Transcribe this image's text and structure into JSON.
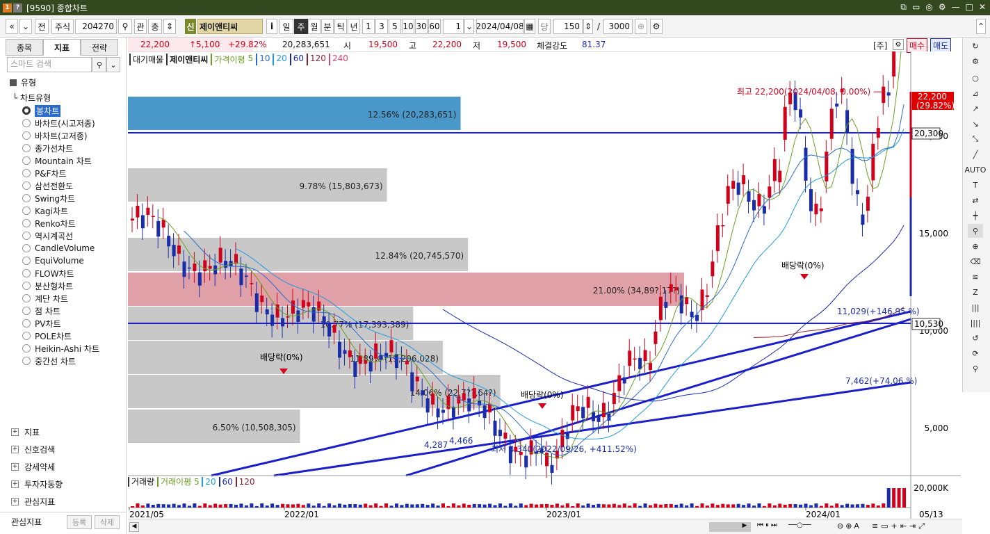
{
  "window": {
    "title": "[9590] 종합차트",
    "icon1": "1",
    "icon2": "?"
  },
  "toolbar": {
    "asset_type": "주식",
    "code": "204270",
    "link_label": "관",
    "sort_label": "충",
    "new_badge": "신",
    "stock_name": "제이앤티씨",
    "info": "i",
    "periods": [
      "일",
      "주",
      "월",
      "분",
      "틱",
      "년"
    ],
    "selected_period": "주",
    "intervals": [
      "1",
      "3",
      "5",
      "10",
      "30",
      "60"
    ],
    "interval_value": "1",
    "date": "2024/04/08",
    "count_label": "당",
    "count": "150",
    "slash": "/",
    "total": "3000"
  },
  "left_panel": {
    "tabs": [
      "종목",
      "지표",
      "전략"
    ],
    "active_tab": "지표",
    "search_placeholder": "스마트 검색",
    "section_title": "유형",
    "subsection": "차트유형",
    "chart_types": [
      "봉차트",
      "바차트(시고저종)",
      "바차트(고저종)",
      "종가선차트",
      "Mountain 차트",
      "P&F차트",
      "삼선전환도",
      "Swing차트",
      "Kagi차트",
      "Renko차트",
      "역시계곡선",
      "CandleVolume",
      "EquiVolume",
      "FLOW차트",
      "분산형차트",
      "계단 차트",
      "점 차트",
      "PV차트",
      "POLE차트",
      "Heikin-Ashi 차트",
      "중간선 차트"
    ],
    "selected_type": "봉차트",
    "expandables": [
      "지표",
      "신호검색",
      "강세약세",
      "투자자동향",
      "관심지표"
    ],
    "footer_label": "관심지표",
    "register": "등록",
    "delete": "삭제"
  },
  "price_bar": {
    "price": "22,200",
    "change": "↑5,100",
    "rate": "+29.82%",
    "volume": "20,283,651",
    "open_label": "시",
    "open": "19,500",
    "high_label": "고",
    "high": "22,200",
    "low_label": "저",
    "low": "19,500",
    "strength_label": "체결강도",
    "strength": "81.37",
    "right_label": "[주]",
    "buy": "매수",
    "sell": "매도"
  },
  "legend": {
    "item1": "대기매물",
    "item2": "제이앤티씨",
    "ma_label": "가격이평",
    "ma": [
      "5",
      "10",
      "20",
      "60",
      "120",
      "240"
    ],
    "ma_colors": [
      "#6aa121",
      "#2a6bd0",
      "#1f9adf",
      "#1a2ca8",
      "#8b1f2f",
      "#e04070"
    ]
  },
  "chart_data": {
    "type": "candlestick",
    "y_axis_ticks": [
      "20,000",
      "15,000",
      "10,000",
      "5,000"
    ],
    "x_axis_ticks": [
      "2021/05",
      "2022/01",
      "2023/01",
      "2024/01"
    ],
    "last_date_label": "05/13",
    "volume_profile": [
      {
        "label": "12.56% (20,283,651)",
        "pct": 12.56,
        "color": "#4a97c9"
      },
      {
        "label": "9.78% (15,803,673)",
        "pct": 9.78,
        "color": "#c8c8c8"
      },
      {
        "label": "12.84% (20,745,570)",
        "pct": 12.84,
        "color": "#c8c8c8"
      },
      {
        "label": "21.00% (34,89?,17?)",
        "pct": 21.0,
        "color": "#e0a0a8"
      },
      {
        "label": "10.77% (17,393,389)",
        "pct": 10.77,
        "color": "#c8c8c8"
      },
      {
        "label": "11.89% (19,206,028)",
        "pct": 11.89,
        "color": "#c8c8c8"
      },
      {
        "label": "14.06% (22,7??,64?)",
        "pct": 14.06,
        "color": "#c8c8c8"
      },
      {
        "label": "6.50% (10,508,305)",
        "pct": 6.5,
        "color": "#c8c8c8"
      }
    ],
    "annotations": {
      "high": "최고 22,200(2024/04/08, 0.00%)",
      "low": "최저 4,340(2022/09/26, +411.52%)",
      "dividend": "배당락(0%)",
      "line1": "11,029(+146.95 %)",
      "line2": "7,462(+74.06 %)",
      "p1": "4,287",
      "p2": "4,466"
    },
    "price_tags": {
      "current": "22,200",
      "current_pct": "(29.82%)",
      "h_line_high": "20,300",
      "h_line_low": "10,530"
    },
    "volume_axis": "20,000K"
  },
  "volume_legend": {
    "title": "거래량",
    "ma_label": "거래이평",
    "ma": [
      "5",
      "20",
      "60",
      "120"
    ]
  }
}
